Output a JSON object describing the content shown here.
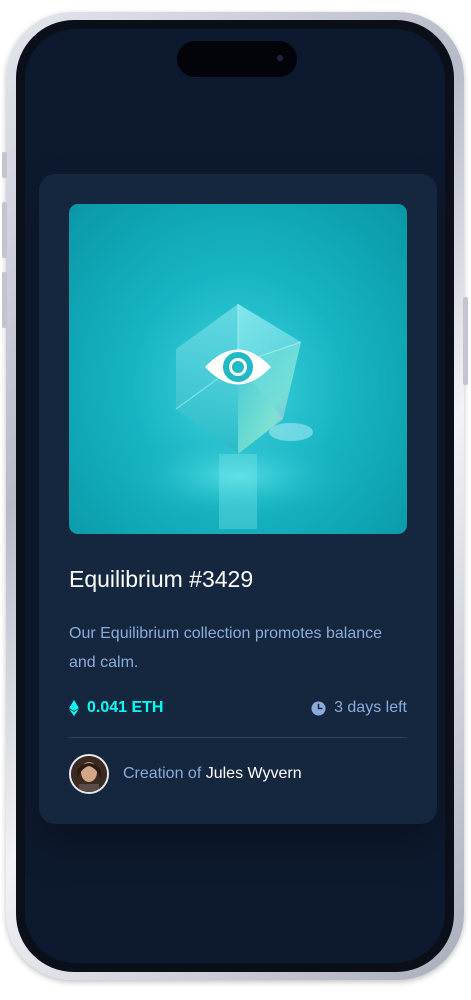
{
  "card": {
    "title": "Equilibrium #3429",
    "description": "Our Equilibrium collection promotes balance and calm.",
    "price": "0.041 ETH",
    "time_left": "3 days left",
    "creator_prefix": "Creation of",
    "creator_name": "Jules Wyvern"
  },
  "icons": {
    "price": "ethereum-icon",
    "time": "clock-icon",
    "image_overlay": "view-eye-icon"
  },
  "colors": {
    "accent": "#00FFF8",
    "soft_blue": "#8BACD9",
    "card_bg": "#15263F",
    "screen_bg": "#0D192E",
    "white": "#FFFFFF"
  }
}
